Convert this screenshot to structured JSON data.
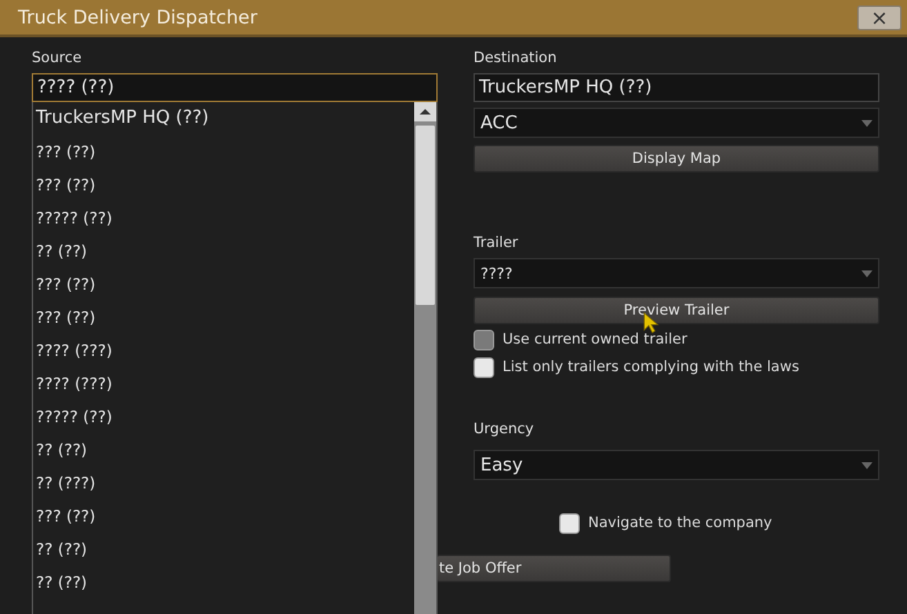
{
  "window": {
    "title": "Truck Delivery Dispatcher",
    "close": "×"
  },
  "source": {
    "label": "Source",
    "value": "???? (??)",
    "focused": true,
    "dropdown_open": true,
    "options": [
      {
        "label": "TruckersMP HQ (??)",
        "kind": "first"
      },
      {
        "label": "??? (??)",
        "kind": "plain"
      },
      {
        "label": "??? (??)",
        "kind": "plain"
      },
      {
        "label": "????? (??)",
        "kind": "plain"
      },
      {
        "label": "?? (??)",
        "kind": "plain"
      },
      {
        "label": "??? (??)",
        "kind": "plain"
      },
      {
        "label": "??? (??)",
        "kind": "plain"
      },
      {
        "label": "???? (???)",
        "kind": "plain"
      },
      {
        "label": "???? (???)",
        "kind": "plain"
      },
      {
        "label": "????? (??)",
        "kind": "plain"
      },
      {
        "label": "?? (??)",
        "kind": "plain"
      },
      {
        "label": "?? (???)",
        "kind": "plain"
      },
      {
        "label": "??? (??)",
        "kind": "plain"
      },
      {
        "label": "?? (??)",
        "kind": "plain"
      },
      {
        "label": "?? (??)",
        "kind": "plain"
      }
    ]
  },
  "destination": {
    "label": "Destination",
    "value": "TruckersMP HQ (??)",
    "company": "ACC",
    "map_button": "Display Map"
  },
  "trailer": {
    "label": "Trailer",
    "value": "????",
    "preview_button": "Preview Trailer",
    "options": [
      {
        "label": "Use current owned trailer",
        "checked": false,
        "disabled": true
      },
      {
        "label": "List only trailers complying with the laws",
        "checked": false,
        "disabled": false
      }
    ]
  },
  "urgency": {
    "label": "Urgency",
    "value": "Easy"
  },
  "navigate": {
    "label": "Navigate to the company",
    "checked": false
  },
  "generate_button": "te Job Offer"
}
